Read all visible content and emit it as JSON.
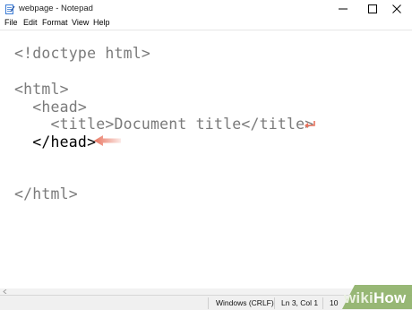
{
  "window": {
    "title": "webpage - Notepad",
    "icon": "notepad-icon"
  },
  "menu": {
    "items": [
      "File",
      "Edit",
      "Format",
      "View",
      "Help"
    ]
  },
  "editor": {
    "lines": [
      "<!doctype html>",
      "",
      "<html>",
      "  <head>",
      "    <title>Document title</title>",
      "  </head>",
      "",
      "",
      "</html>"
    ],
    "arrow_color": "#e8735e"
  },
  "status": {
    "line_ending": "Windows (CRLF)",
    "position": "Ln 3, Col 1",
    "partial": "10"
  },
  "watermark": {
    "wiki": "wiki",
    "how": "How"
  }
}
